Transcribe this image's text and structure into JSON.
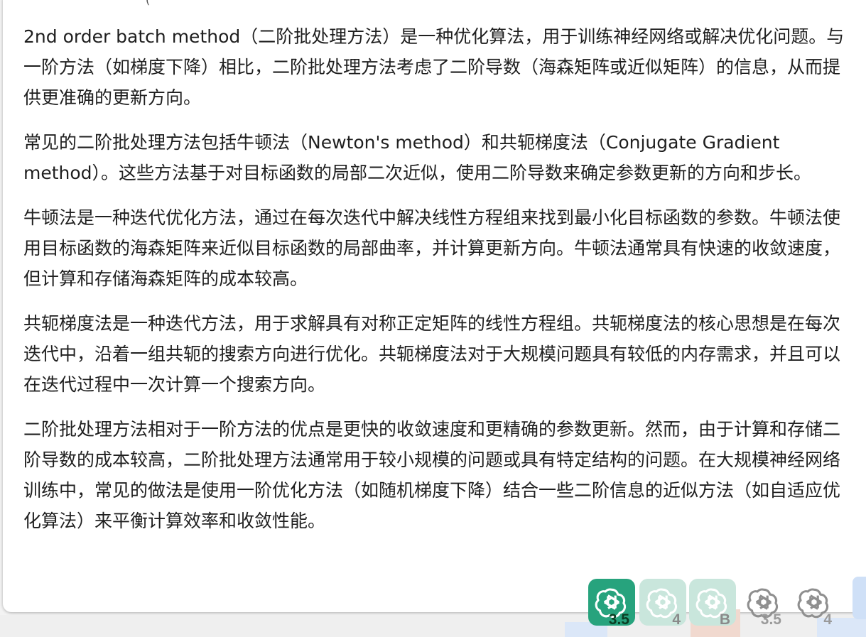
{
  "top_partial_text": "(",
  "paragraphs": [
    "2nd order batch method（二阶批处理方法）是一种优化算法，用于训练神经网络或解决优化问题。与一阶方法（如梯度下降）相比，二阶批处理方法考虑了二阶导数（海森矩阵或近似矩阵）的信息，从而提供更准确的更新方向。",
    "常见的二阶批处理方法包括牛顿法（Newton's method）和共轭梯度法（Conjugate Gradient method）。这些方法基于对目标函数的局部二次近似，使用二阶导数来确定参数更新的方向和步长。",
    "牛顿法是一种迭代优化方法，通过在每次迭代中解决线性方程组来找到最小化目标函数的参数。牛顿法使用目标函数的海森矩阵来近似目标函数的局部曲率，并计算更新方向。牛顿法通常具有快速的收敛速度，但计算和存储海森矩阵的成本较高。",
    "共轭梯度法是一种迭代方法，用于求解具有对称正定矩阵的线性方程组。共轭梯度法的核心思想是在每次迭代中，沿着一组共轭的搜索方向进行优化。共轭梯度法对于大规模问题具有较低的内存需求，并且可以在迭代过程中一次计算一个搜索方向。",
    "二阶批处理方法相对于一阶方法的优点是更快的收敛速度和更精确的参数更新。然而，由于计算和存储二阶导数的成本较高，二阶批处理方法通常用于较小规模的问题或具有特定结构的问题。在大规模神经网络训练中，常见的做法是使用一阶优化方法（如随机梯度下降）结合一些二阶信息的近似方法（如自适应优化算法）来平衡计算效率和收敛性能。"
  ],
  "model_tiles": [
    {
      "label": "3.5",
      "icon": "openai-logo-icon",
      "bg": "#27a37d",
      "icon_color": "#ffffff",
      "label_color": "#0b3d22"
    },
    {
      "label": "4",
      "icon": "openai-logo-icon",
      "bg": "#c9e6dc",
      "icon_color": "#ffffff",
      "label_color": "#8a8a8a"
    },
    {
      "label": "B",
      "icon": "openai-logo-icon",
      "bg": "#c9e6dc",
      "icon_color": "#ffffff",
      "label_color": "#8a8a8a"
    },
    {
      "label": "3.5",
      "icon": "openai-logo-icon",
      "bg": "transparent",
      "icon_color": "#8f8f8f",
      "label_color": "#9a9a9a"
    },
    {
      "label": "4",
      "icon": "openai-logo-icon",
      "bg": "transparent",
      "icon_color": "#8f8f8f",
      "label_color": "#9a9a9a"
    }
  ]
}
